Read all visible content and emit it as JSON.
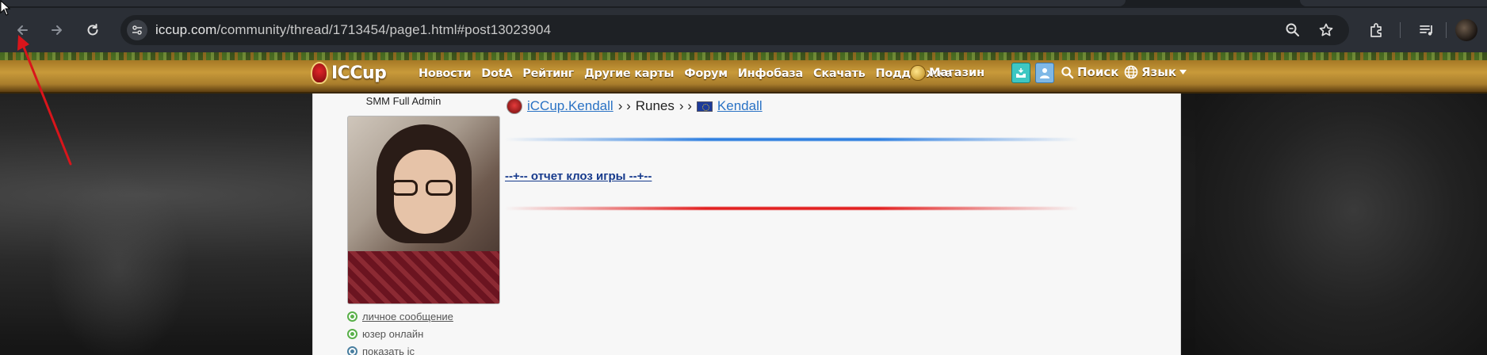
{
  "browser": {
    "url_host": "iccup.com",
    "url_path": "/community/thread/1713454/page1.html#post13023904",
    "icons": [
      "back-icon",
      "forward-icon",
      "reload-icon",
      "site-info-icon",
      "zoom-icon",
      "bookmark-star-icon",
      "extensions-icon",
      "media-controls-icon",
      "profile-avatar"
    ]
  },
  "site": {
    "logo_text": "ICCup",
    "menu": [
      "Новости",
      "DotA",
      "Рейтинг",
      "Другие карты",
      "Форум",
      "Инфобаза",
      "Скачать",
      "Поддержка"
    ],
    "shop_label": "Магазин",
    "search_label": "Поиск",
    "lang_label": "Язык",
    "colors": {
      "nav_gold": "#c89a3a",
      "link_blue": "#2a72c4",
      "blue_line": "#2f7fe0",
      "red_line": "#e21f1f"
    }
  },
  "user": {
    "role": "SMM Full Admin",
    "links": [
      {
        "label": "личное сообщение",
        "icon": "message-icon"
      },
      {
        "label": "юзер онлайн",
        "icon": "online-status-icon"
      },
      {
        "label": "показать іс",
        "icon": "show-icon"
      }
    ]
  },
  "post": {
    "crumb_1": "iCCup.Kendall",
    "sep_1": "› ›",
    "crumb_2": "Runes",
    "sep_2": "› ›",
    "crumb_3": "Kendall",
    "link_text": "--+-- отчет клоз игры --+--"
  }
}
